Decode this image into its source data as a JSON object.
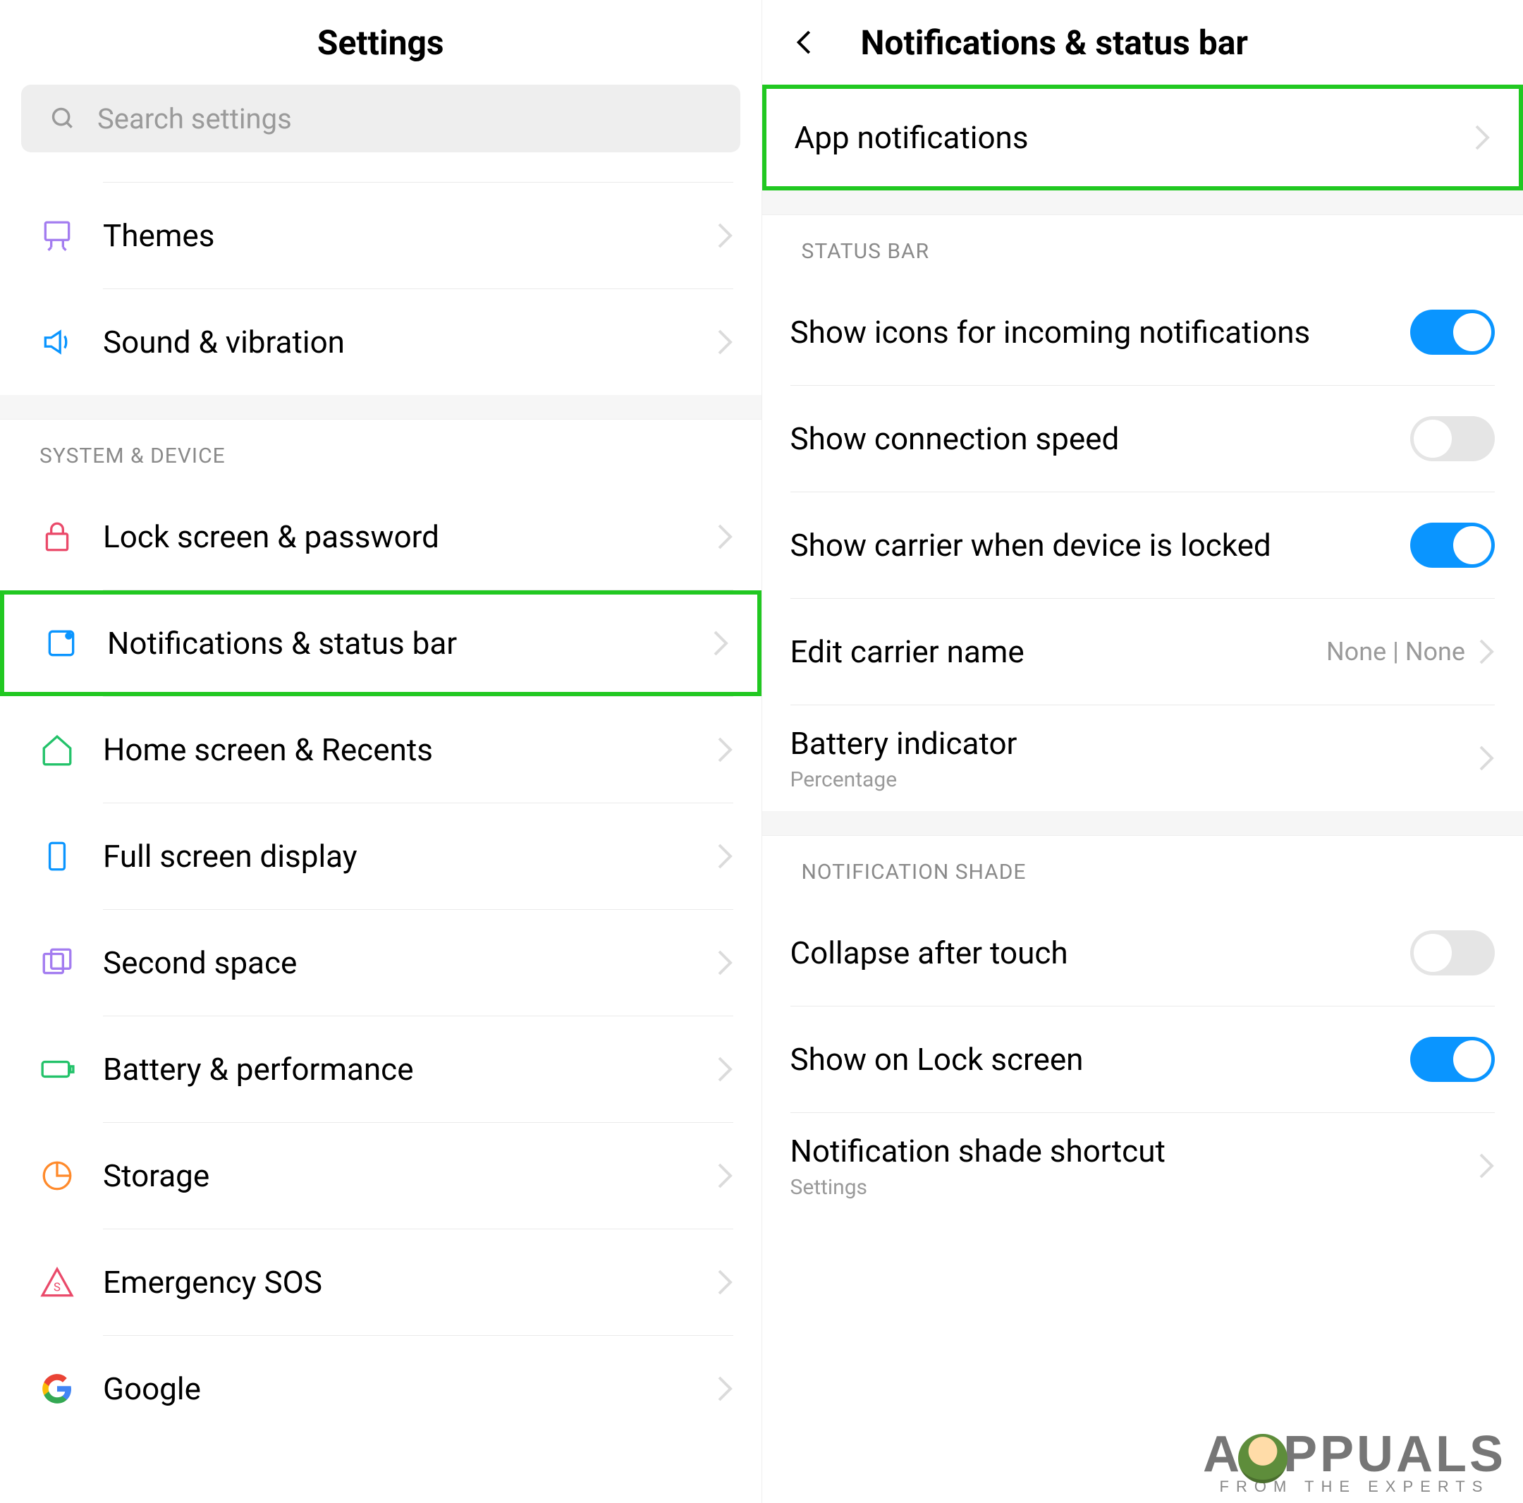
{
  "left": {
    "title": "Settings",
    "search_placeholder": "Search settings",
    "group1": [
      {
        "label": "Themes"
      },
      {
        "label": "Sound & vibration"
      }
    ],
    "section_system_device": "SYSTEM & DEVICE",
    "group2": [
      {
        "label": "Lock screen & password"
      },
      {
        "label": "Notifications & status bar",
        "highlight": true
      },
      {
        "label": "Home screen & Recents"
      },
      {
        "label": "Full screen display"
      },
      {
        "label": "Second space"
      },
      {
        "label": "Battery & performance"
      },
      {
        "label": "Storage"
      },
      {
        "label": "Emergency SOS"
      },
      {
        "label": "Google"
      }
    ]
  },
  "right": {
    "title": "Notifications & status bar",
    "app_notifications": {
      "label": "App notifications",
      "highlight": true
    },
    "section_status_bar": "STATUS BAR",
    "status_bar_items": [
      {
        "label": "Show icons for incoming notifications",
        "type": "toggle",
        "value": true
      },
      {
        "label": "Show connection speed",
        "type": "toggle",
        "value": false
      },
      {
        "label": "Show carrier when device is locked",
        "type": "toggle",
        "value": true
      },
      {
        "label": "Edit carrier name",
        "type": "nav",
        "trail": "None | None"
      },
      {
        "label": "Battery indicator",
        "sub": "Percentage",
        "type": "nav"
      }
    ],
    "section_notification_shade": "NOTIFICATION SHADE",
    "shade_items": [
      {
        "label": "Collapse after touch",
        "type": "toggle",
        "value": false
      },
      {
        "label": "Show on Lock screen",
        "type": "toggle",
        "value": true
      },
      {
        "label": "Notification shade shortcut",
        "sub": "Settings",
        "type": "nav"
      }
    ]
  },
  "watermark": {
    "brand_pre": "A",
    "brand_post": "PPUALS",
    "tagline": "FROM THE EXPERTS"
  },
  "colors": {
    "accent": "#0a95ff",
    "highlight": "#21c821"
  }
}
